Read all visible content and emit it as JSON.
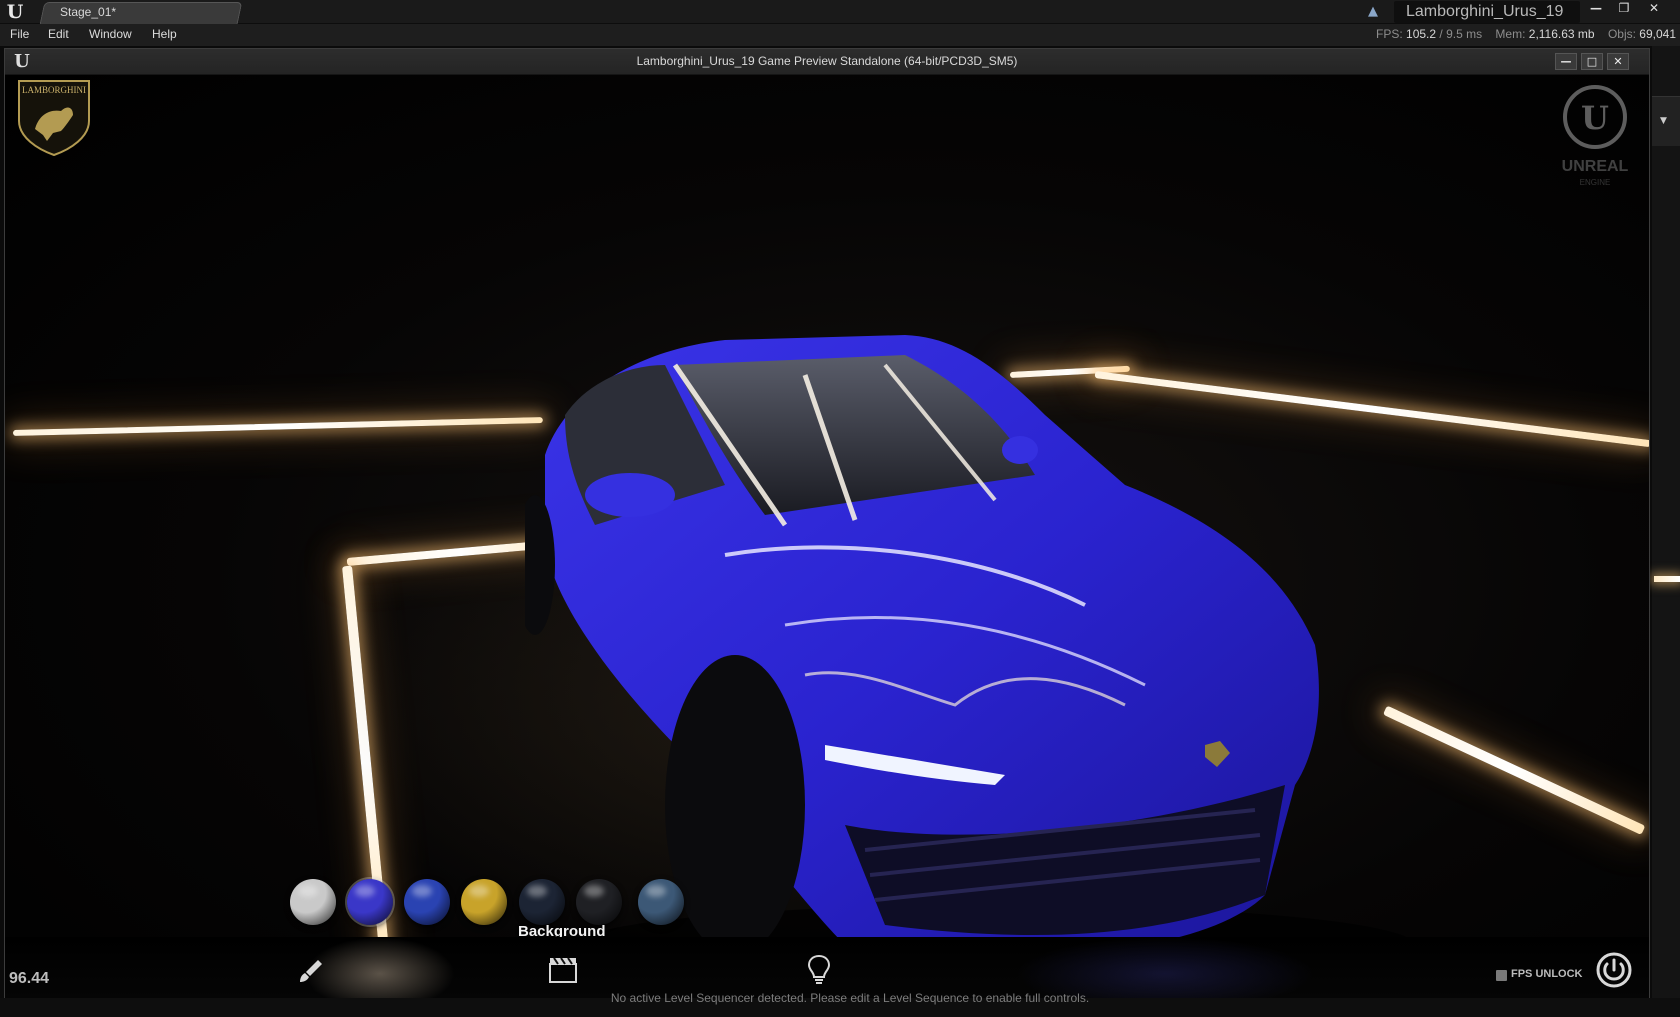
{
  "editor": {
    "logo_icon": "unreal-logo-icon",
    "stage_tab": "Stage_01*",
    "project_name": "Lamborghini_Urus_19",
    "menu": [
      "File",
      "Edit",
      "Window",
      "Help"
    ],
    "stats": {
      "fps_label": "FPS:",
      "fps": "105.2",
      "frame_ms": "9.5 ms",
      "mem_label": "Mem:",
      "mem": "2,116.63 mb",
      "objs_label": "Objs:",
      "objs": "69,041"
    },
    "window_controls": [
      "minimize-icon",
      "restore-icon",
      "close-icon"
    ]
  },
  "game_window": {
    "title": "Lamborghini_Urus_19 Game Preview Standalone (64-bit/PCD3D_SM5)",
    "controls": [
      "minimize-icon",
      "maximize-icon",
      "close-icon"
    ]
  },
  "hud": {
    "brand_logo": "lamborghini-shield-logo",
    "brand_logo_text": "LAMBORGHINI",
    "engine_watermark": "unreal-engine-watermark",
    "engine_watermark_text": "UNREAL",
    "engine_watermark_subtext": "ENGINE",
    "paint_swatches": [
      {
        "name": "white",
        "color": "#c9c9c9"
      },
      {
        "name": "blue-selected",
        "color": "#3a37c8",
        "selected": true
      },
      {
        "name": "blue",
        "color": "#2a43b2"
      },
      {
        "name": "yellow",
        "color": "#c8a32a"
      },
      {
        "name": "black-blue",
        "color": "#1c2434"
      },
      {
        "name": "black",
        "color": "#1f2024"
      },
      {
        "name": "steel-blue",
        "color": "#3c5876"
      }
    ],
    "swatch_tooltip": "Background",
    "fps_value": "96.44",
    "toolbar_icons": [
      "brush-icon",
      "clapperboard-icon",
      "lightbulb-icon"
    ],
    "fps_unlock_label": "FPS UNLOCK",
    "power_icon": "power-icon",
    "car_color": "#2c25d6"
  },
  "status": {
    "sequencer_message": "No active Level Sequencer detected. Please edit a Level Sequence to enable full controls."
  }
}
